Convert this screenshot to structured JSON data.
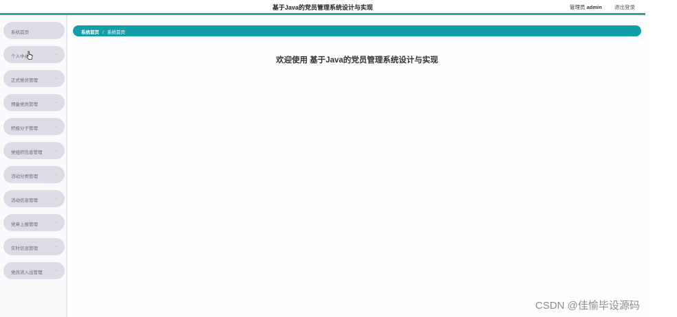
{
  "header": {
    "title": "基于Java的党员管理系统设计与实现",
    "role_label": "管理员",
    "username": "admin",
    "logout_label": "退出登录"
  },
  "sidebar": {
    "items": [
      {
        "label": "系统首页",
        "has_arrow": false
      },
      {
        "label": "个人中心",
        "has_arrow": true
      },
      {
        "label": "正式党员管理",
        "has_arrow": true
      },
      {
        "label": "预备党员管理",
        "has_arrow": true
      },
      {
        "label": "积极分子管理",
        "has_arrow": true
      },
      {
        "label": "党组织信息管理",
        "has_arrow": true
      },
      {
        "label": "活动分类管理",
        "has_arrow": true
      },
      {
        "label": "活动信息管理",
        "has_arrow": true
      },
      {
        "label": "党章上报管理",
        "has_arrow": true
      },
      {
        "label": "实时信息管理",
        "has_arrow": true
      },
      {
        "label": "党员流入出管理",
        "has_arrow": true
      }
    ]
  },
  "breadcrumb": {
    "home": "系统首页",
    "separator": "/",
    "current": "系统首页"
  },
  "main": {
    "welcome": "欢迎使用 基于Java的党员管理系统设计与实现"
  },
  "watermark": "CSDN @佳愉毕设源码",
  "colors": {
    "accent": "#139ea7",
    "header_rule": "#2aa3a3",
    "nav_item_bg": "#dcdce7"
  }
}
